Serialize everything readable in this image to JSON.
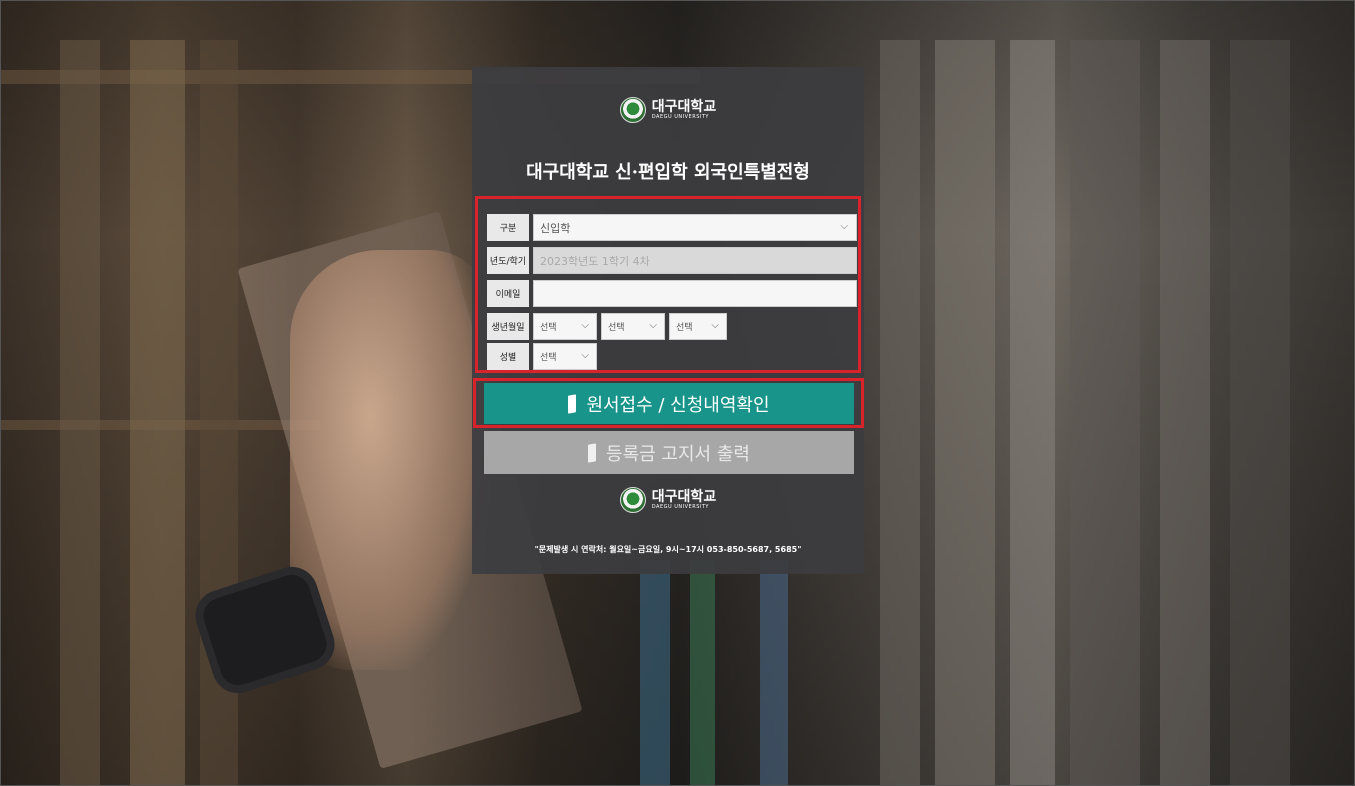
{
  "header": {
    "logo_kr": "대구대학교",
    "logo_en": "DAEGU UNIVERSITY",
    "title": "대구대학교 신·편입학 외국인특별전형"
  },
  "form": {
    "type": {
      "label": "구분",
      "value": "신입학"
    },
    "term": {
      "label": "년도/학기",
      "value": "2023학년도 1학기 4차"
    },
    "email": {
      "label": "이메일",
      "value": ""
    },
    "birth": {
      "label": "생년월일",
      "year": "선택",
      "month": "선택",
      "day": "선택"
    },
    "gender": {
      "label": "성별",
      "value": "선택"
    }
  },
  "buttons": {
    "apply": "원서접수 / 신청내역확인",
    "invoice": "등록금 고지서 출력"
  },
  "footer": {
    "logo_kr": "대구대학교",
    "logo_en": "DAEGU UNIVERSITY",
    "contact": "\"문제발생 시 연락처: 월요일~금요일, 9시~17시 053-850-5687, 5685\""
  },
  "colors": {
    "primary_button": "#18948a",
    "secondary_button": "#a7a7a7",
    "highlight_border": "#d8232a",
    "panel": "#3c3c40"
  },
  "icons": {
    "dropdown": "chevron-down-icon",
    "button": "door-icon",
    "emblem": "university-emblem-icon"
  }
}
